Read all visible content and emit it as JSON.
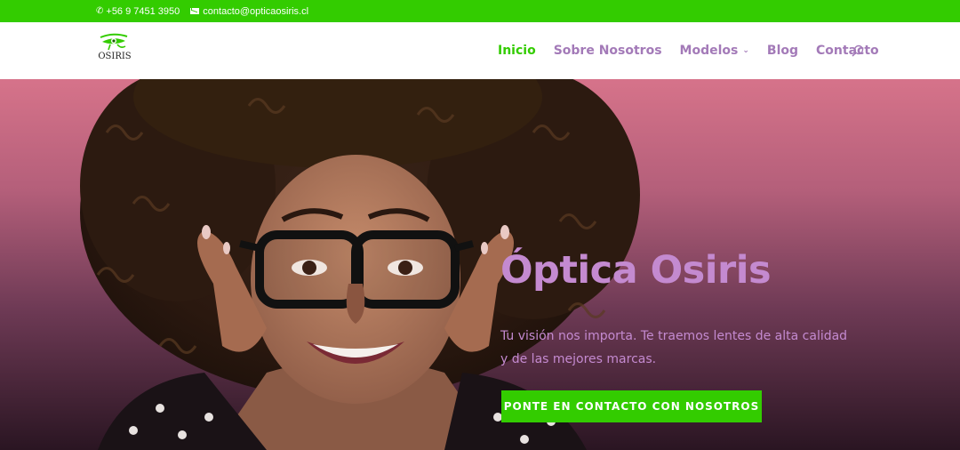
{
  "topbar": {
    "phone": "+56 9 7451 3950",
    "email": "contacto@opticaosiris.cl",
    "phone_icon": "phone-icon",
    "email_icon": "envelope-icon"
  },
  "header": {
    "logo_text": "OSIRIS",
    "nav": {
      "inicio": "Inicio",
      "sobre": "Sobre Nosotros",
      "modelos": "Modelos",
      "blog": "Blog",
      "contacto": "Contacto"
    },
    "search_icon": "search-icon"
  },
  "hero": {
    "title": "Óptica Osiris",
    "subtitle_line1": "Tu visión nos importa. Te traemos lentes de alta calidad",
    "subtitle_line2": "y de las mejores marcas.",
    "cta": "PONTE EN CONTACTO CON NOSOTROS"
  },
  "colors": {
    "accent_green": "#33cc00",
    "nav_purple": "#a37ab8",
    "hero_text": "#c48ad0"
  }
}
